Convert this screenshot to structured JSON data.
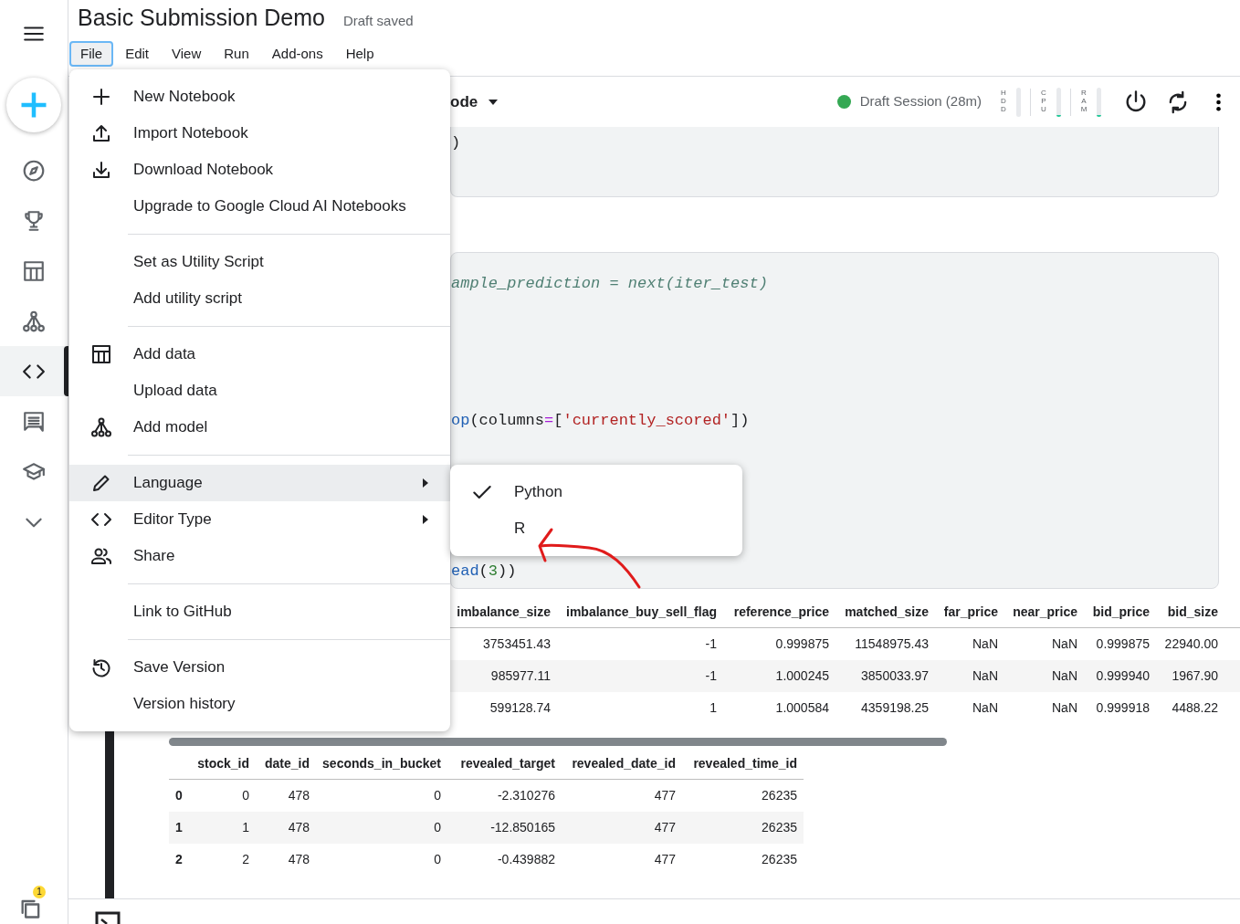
{
  "app": {
    "title": "Basic Submission Demo",
    "save_status": "Draft saved"
  },
  "menubar": [
    {
      "label": "File",
      "selected": true
    },
    {
      "label": "Edit",
      "selected": false
    },
    {
      "label": "View",
      "selected": false
    },
    {
      "label": "Run",
      "selected": false
    },
    {
      "label": "Add-ons",
      "selected": false
    },
    {
      "label": "Help",
      "selected": false
    }
  ],
  "sidebar": {
    "items": [
      {
        "selected": false
      },
      {
        "selected": false
      },
      {
        "selected": false
      },
      {
        "selected": false
      },
      {
        "selected": true
      },
      {
        "selected": false
      },
      {
        "selected": false
      },
      {
        "selected": false
      }
    ],
    "notification_badge": "1"
  },
  "toolbar": {
    "editor_type": "ode",
    "session": "Draft Session (28m)",
    "meters": [
      {
        "label": "HDD",
        "level": 0
      },
      {
        "label": "CPU",
        "level": 0.05
      },
      {
        "label": "RAM",
        "level": 0.05
      }
    ]
  },
  "file_menu": [
    {
      "kind": "item",
      "label": "New Notebook",
      "selected": false,
      "has_submenu": false
    },
    {
      "kind": "item",
      "label": "Import Notebook",
      "selected": false,
      "has_submenu": false
    },
    {
      "kind": "item",
      "label": "Download Notebook",
      "selected": false,
      "has_submenu": false
    },
    {
      "kind": "item",
      "label": "Upgrade to Google Cloud AI Notebooks",
      "selected": false,
      "has_submenu": false
    },
    {
      "kind": "divider"
    },
    {
      "kind": "item",
      "label": "Set as Utility Script",
      "selected": false,
      "has_submenu": false
    },
    {
      "kind": "item",
      "label": "Add utility script",
      "selected": false,
      "has_submenu": false
    },
    {
      "kind": "divider"
    },
    {
      "kind": "item",
      "label": "Add data",
      "selected": false,
      "has_submenu": false
    },
    {
      "kind": "item",
      "label": "Upload data",
      "selected": false,
      "has_submenu": false
    },
    {
      "kind": "item",
      "label": "Add model",
      "selected": false,
      "has_submenu": false
    },
    {
      "kind": "divider"
    },
    {
      "kind": "item",
      "label": "Language",
      "selected": true,
      "has_submenu": true
    },
    {
      "kind": "item",
      "label": "Editor Type",
      "selected": false,
      "has_submenu": true
    },
    {
      "kind": "item",
      "label": "Share",
      "selected": false,
      "has_submenu": false
    },
    {
      "kind": "divider"
    },
    {
      "kind": "item",
      "label": "Link to GitHub",
      "selected": false,
      "has_submenu": false
    },
    {
      "kind": "divider"
    },
    {
      "kind": "item",
      "label": "Save Version",
      "selected": false,
      "has_submenu": false
    },
    {
      "kind": "item",
      "label": "Version history",
      "selected": false,
      "has_submenu": false
    }
  ],
  "language_menu": [
    {
      "label": "Python",
      "checked": true
    },
    {
      "label": "R",
      "checked": false
    }
  ],
  "cells": [
    {
      "lines": [
        [
          {
            "kind": "text",
            "text": ")"
          }
        ]
      ]
    },
    {
      "lines": [
        [
          {
            "kind": "comment",
            "text": "ample_prediction = next(iter_test)"
          }
        ],
        [
          {
            "kind": "function",
            "text": "op"
          },
          {
            "kind": "text",
            "text": "(columns"
          },
          {
            "kind": "operator",
            "text": "="
          },
          {
            "kind": "text",
            "text": "["
          },
          {
            "kind": "string",
            "text": "'currently_scored'"
          },
          {
            "kind": "text",
            "text": "])"
          }
        ],
        [
          {
            "kind": "function",
            "text": "ead"
          },
          {
            "kind": "text",
            "text": "("
          },
          {
            "kind": "number",
            "text": "3"
          },
          {
            "kind": "text",
            "text": "))"
          }
        ]
      ]
    }
  ],
  "output_table": {
    "columns": [
      "imbalance_size",
      "imbalance_buy_sell_flag",
      "reference_price",
      "matched_size",
      "far_price",
      "near_price",
      "bid_price",
      "bid_size"
    ],
    "rows": [
      [
        "3753451.43",
        "-1",
        "0.999875",
        "11548975.43",
        "NaN",
        "NaN",
        "0.999875",
        "22940.00"
      ],
      [
        "985977.11",
        "-1",
        "1.000245",
        "3850033.97",
        "NaN",
        "NaN",
        "0.999940",
        "1967.90"
      ],
      [
        "599128.74",
        "1",
        "1.000584",
        "4359198.25",
        "NaN",
        "NaN",
        "0.999918",
        "4488.22"
      ]
    ]
  },
  "result_table": {
    "columns": [
      "stock_id",
      "date_id",
      "seconds_in_bucket",
      "revealed_target",
      "revealed_date_id",
      "revealed_time_id"
    ],
    "rows": [
      {
        "index": "0",
        "cells": [
          "0",
          "478",
          "0",
          "-2.310276",
          "477",
          "26235"
        ]
      },
      {
        "index": "1",
        "cells": [
          "1",
          "478",
          "0",
          "-12.850165",
          "477",
          "26235"
        ]
      },
      {
        "index": "2",
        "cells": [
          "2",
          "478",
          "0",
          "-0.439882",
          "477",
          "26235"
        ]
      }
    ]
  }
}
